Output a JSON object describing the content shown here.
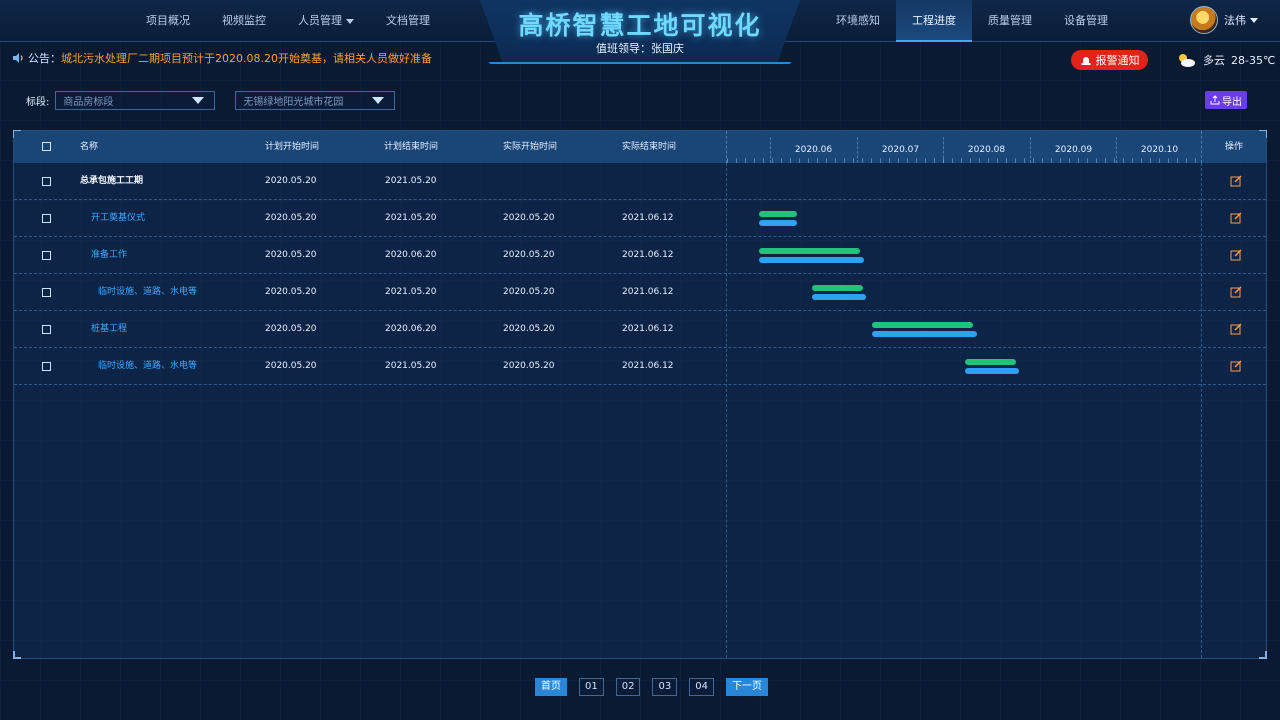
{
  "header": {
    "title": "高桥智慧工地可视化",
    "duty": "值班领导：张国庆",
    "nav_left": [
      {
        "label": "项目概况"
      },
      {
        "label": "视频监控"
      },
      {
        "label": "人员管理",
        "dropdown": true
      },
      {
        "label": "文档管理"
      }
    ],
    "nav_right": [
      {
        "label": "环境感知"
      },
      {
        "label": "工程进度",
        "active": true
      },
      {
        "label": "质量管理"
      },
      {
        "label": "设备管理"
      }
    ],
    "user": {
      "name": "法伟"
    }
  },
  "notice": {
    "label": "公告：",
    "text": "城北污水处理厂二期项目预计于2020.08.20开始奠基，请相关人员做好准备"
  },
  "alarm_label": "报警通知",
  "weather": {
    "condition": "多云",
    "temperature": "28-35℃"
  },
  "filter": {
    "label": "标段:",
    "select1": "商品房标段",
    "select2": "无锡绿地阳光城市花园"
  },
  "export_label": "导出",
  "table": {
    "columns": {
      "name": "名称",
      "plan_start": "计划开始时间",
      "plan_end": "计划结束时间",
      "actual_start": "实际开始时间",
      "actual_end": "实际结束时间",
      "action": "操作"
    },
    "months": [
      "2020.06",
      "2020.07",
      "2020.08",
      "2020.09",
      "2020.10"
    ],
    "rows": [
      {
        "name": "总承包施工工期",
        "plan_start": "2020.05.20",
        "plan_end": "2021.05.20",
        "actual_start": "",
        "actual_end": ""
      },
      {
        "name": "开工奠基仪式",
        "plan_start": "2020.05.20",
        "plan_end": "2021.05.20",
        "actual_start": "2020.05.20",
        "actual_end": "2021.06.12"
      },
      {
        "name": "准备工作",
        "plan_start": "2020.05.20",
        "plan_end": "2020.06.20",
        "actual_start": "2020.05.20",
        "actual_end": "2021.06.12"
      },
      {
        "name": "临时设施、道路、水电等",
        "plan_start": "2020.05.20",
        "plan_end": "2021.05.20",
        "actual_start": "2020.05.20",
        "actual_end": "2021.06.12"
      },
      {
        "name": "桩基工程",
        "plan_start": "2020.05.20",
        "plan_end": "2020.06.20",
        "actual_start": "2020.05.20",
        "actual_end": "2021.06.12"
      },
      {
        "name": "临时设施、道路、水电等",
        "plan_start": "2020.05.20",
        "plan_end": "2021.05.20",
        "actual_start": "2020.05.20",
        "actual_end": "2021.06.12"
      }
    ]
  },
  "pagination": {
    "first": "首页",
    "pages": [
      "01",
      "02",
      "03",
      "04"
    ],
    "next": "下一页"
  },
  "colors": {
    "accent": "#3fa9ff",
    "plan_bar": "#1ec47a",
    "actual_bar": "#2aa3f0",
    "alarm": "#e2231a",
    "notice_text": "#ff9f2e",
    "export": "#6a3de8"
  },
  "icons": {
    "speaker": "speaker-icon",
    "alarm": "alarm-light-icon",
    "weather": "cloud-sun-icon",
    "export": "upload-icon",
    "edit": "edit-icon"
  }
}
